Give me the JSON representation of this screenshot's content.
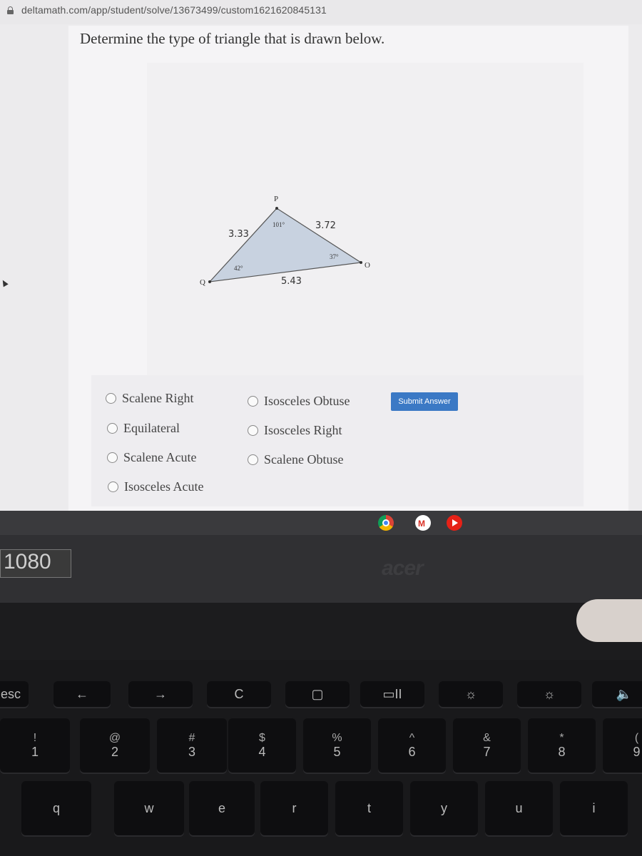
{
  "browser": {
    "url": "deltamath.com/app/student/solve/13673499/custom1621620845131"
  },
  "question": {
    "prompt": "Determine the type of triangle that is drawn below."
  },
  "triangle": {
    "vertices": {
      "P": "P",
      "Q": "Q",
      "O": "O"
    },
    "angles": {
      "P": "101°",
      "Q": "42°",
      "O": "37°"
    },
    "sides": {
      "PQ": "3.33",
      "PO": "3.72",
      "QO": "5.43"
    },
    "fill_color": "#c8d2e0"
  },
  "answers": {
    "options": [
      {
        "label": "Scalene Right"
      },
      {
        "label": "Equilateral"
      },
      {
        "label": "Scalene Acute"
      },
      {
        "label": "Isosceles Acute"
      },
      {
        "label": "Isosceles Obtuse"
      },
      {
        "label": "Isosceles Right"
      },
      {
        "label": "Scalene Obtuse"
      }
    ],
    "submit_label": "Submit Answer",
    "submit_color": "#3b79c5"
  },
  "shelf": {
    "apps": [
      "chrome-icon",
      "gmail-icon",
      "youtube-icon"
    ]
  },
  "bezel": {
    "sticker_text": "1080",
    "brand": "acer"
  },
  "keyboard": {
    "row1": [
      "esc",
      "←",
      "→",
      "C",
      "▢",
      "▭II",
      "☼",
      "☼",
      "🔈"
    ],
    "row2": [
      {
        "top": "!",
        "bot": "1"
      },
      {
        "top": "@",
        "bot": "2"
      },
      {
        "top": "#",
        "bot": "3"
      },
      {
        "top": "$",
        "bot": "4"
      },
      {
        "top": "%",
        "bot": "5"
      },
      {
        "top": "^",
        "bot": "6"
      },
      {
        "top": "&",
        "bot": "7"
      },
      {
        "top": "*",
        "bot": "8"
      },
      {
        "top": "(",
        "bot": "9"
      }
    ],
    "row3": [
      "q",
      "w",
      "e",
      "r",
      "t",
      "y",
      "u",
      "i"
    ]
  }
}
